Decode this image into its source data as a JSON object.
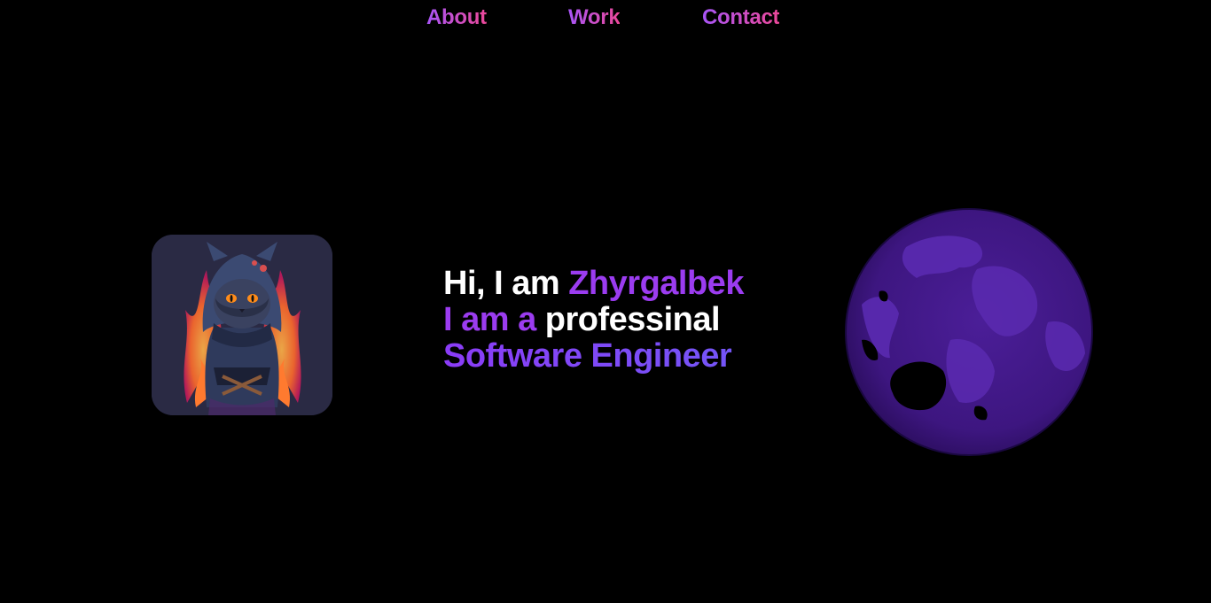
{
  "nav": {
    "about": "About",
    "work": "Work",
    "contact": "Contact"
  },
  "hero": {
    "greeting": "Hi, I am",
    "name": "Zhyrgalbek",
    "role_prefix": "I am a",
    "role_adjective": "professinal",
    "role_title": "Software Engineer"
  },
  "colors": {
    "background": "#000000",
    "nav_gradient_start": "#a855f7",
    "nav_gradient_end": "#ec4899",
    "accent_purple": "#9b3cf0",
    "accent_violet": "#6d5df7",
    "globe_purple": "#4a1a96",
    "avatar_bg": "#2a2a44"
  },
  "icons": {
    "avatar": "hooded-cat-with-flames-avatar",
    "globe": "earth-globe-3d"
  }
}
